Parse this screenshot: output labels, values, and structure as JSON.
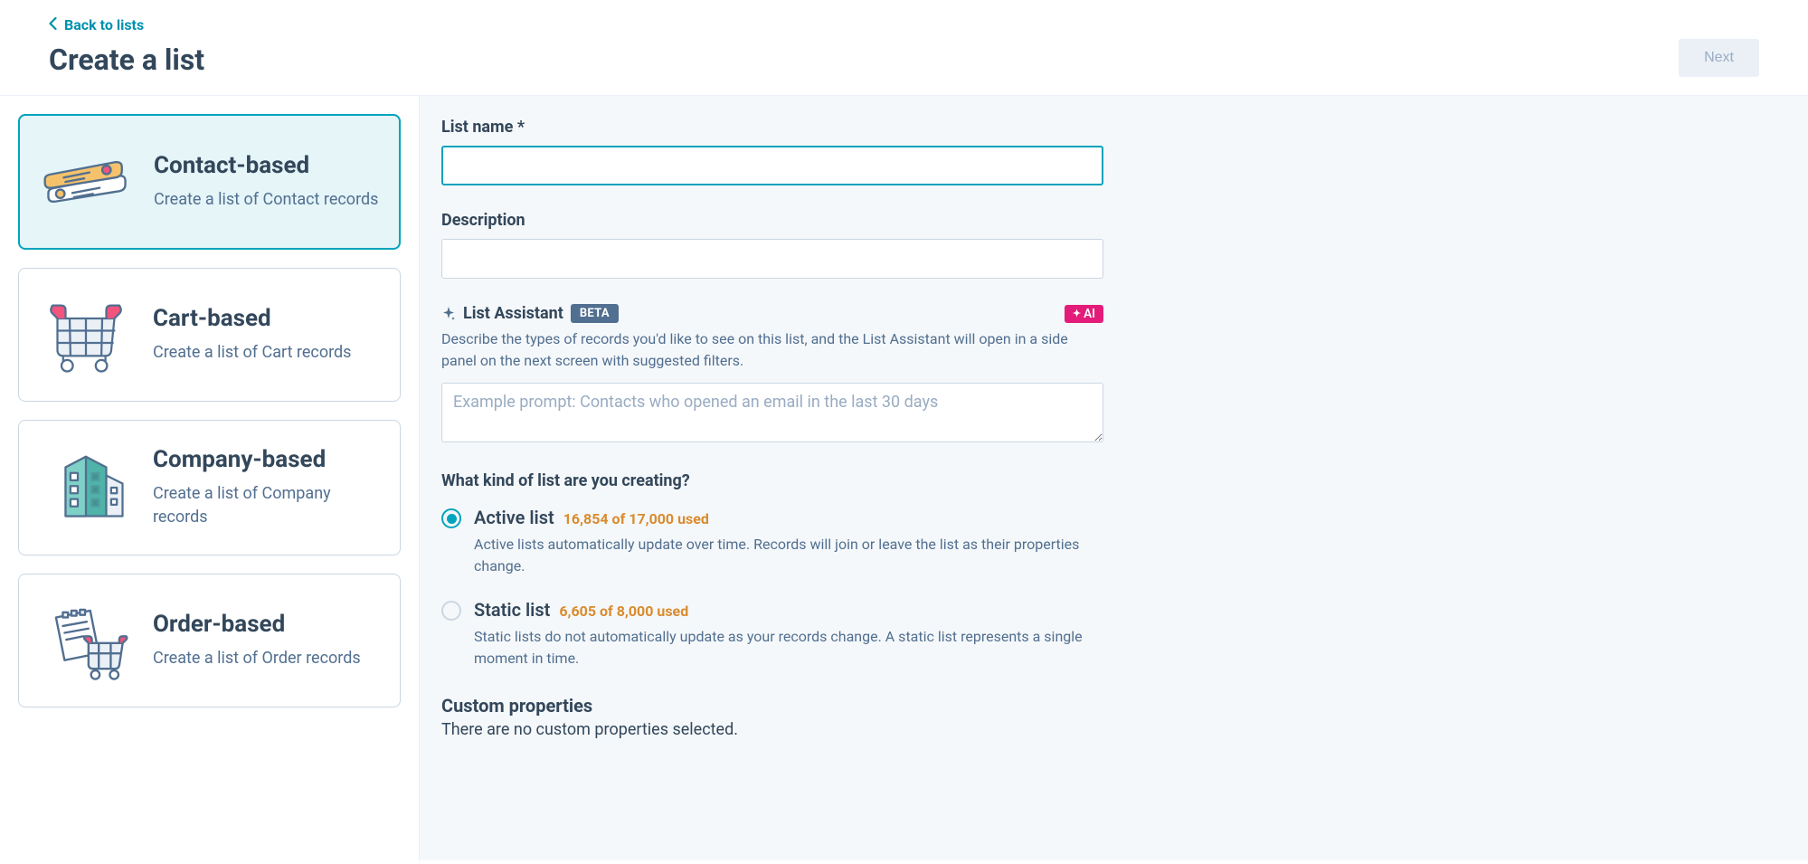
{
  "header": {
    "back_label": "Back to lists",
    "title": "Create a list",
    "next_label": "Next"
  },
  "sidebar": {
    "cards": [
      {
        "title": "Contact-based",
        "desc": "Create a list of Contact records",
        "selected": true
      },
      {
        "title": "Cart-based",
        "desc": "Create a list of Cart records",
        "selected": false
      },
      {
        "title": "Company-based",
        "desc": "Create a list of Company records",
        "selected": false
      },
      {
        "title": "Order-based",
        "desc": "Create a list of Order records",
        "selected": false
      }
    ]
  },
  "form": {
    "list_name_label": "List name *",
    "list_name_value": "",
    "description_label": "Description",
    "description_value": "",
    "assistant": {
      "title": "List Assistant",
      "beta": "BETA",
      "ai": "AI",
      "desc": "Describe the types of records you'd like to see on this list, and the List Assistant will open in a side panel on the next screen with suggested filters.",
      "placeholder": "Example prompt: Contacts who opened an email in the last 30 days"
    },
    "kind_heading": "What kind of list are you creating?",
    "radios": [
      {
        "label": "Active list",
        "usage": "16,854 of 17,000 used",
        "desc": "Active lists automatically update over time. Records will join or leave the list as their properties change.",
        "checked": true
      },
      {
        "label": "Static list",
        "usage": "6,605 of 8,000 used",
        "desc": "Static lists do not automatically update as your records change. A static list represents a single moment in time.",
        "checked": false
      }
    ],
    "custom_props_heading": "Custom properties",
    "custom_props_text": "There are no custom properties selected."
  }
}
